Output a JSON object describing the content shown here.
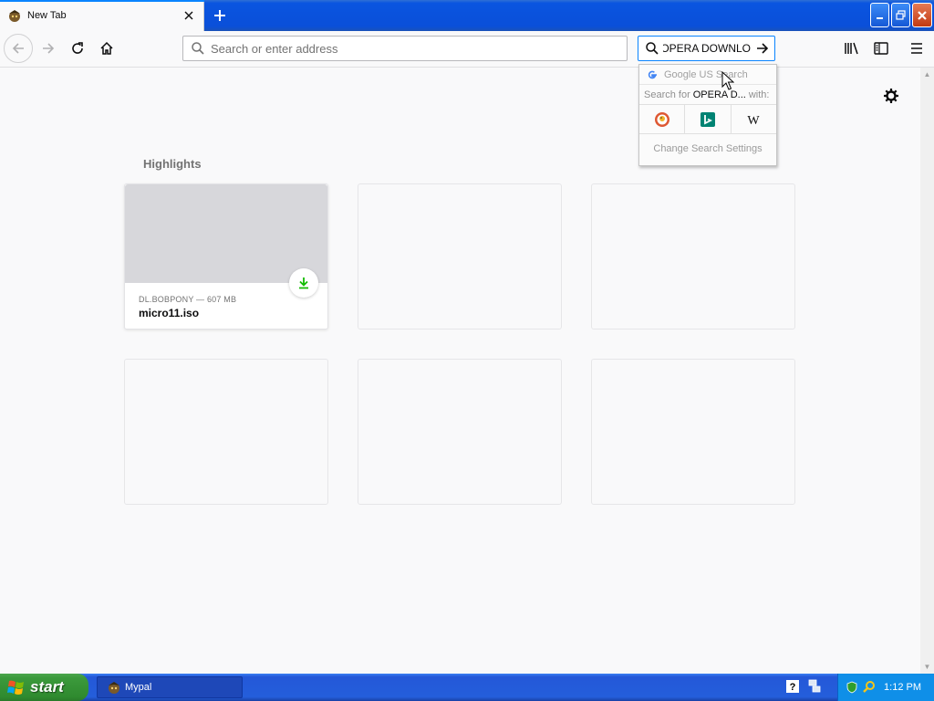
{
  "browser": {
    "tab": {
      "title": "New Tab"
    },
    "urlbar": {
      "placeholder": "Search or enter address"
    },
    "searchbar": {
      "value": "OPERA DOWNLO"
    }
  },
  "search_popup": {
    "default_engine": "Google US Search",
    "search_for_prefix": "Search for",
    "search_for_query": "OPERA D...",
    "search_for_suffix": "with:",
    "engines": [
      "duckduckgo-icon",
      "bing-icon",
      "wikipedia-icon"
    ],
    "settings_label": "Change Search Settings"
  },
  "newtab": {
    "highlights_title": "Highlights",
    "cards": [
      {
        "source": "DL.BOBPONY — 607 MB",
        "name": "micro11.iso",
        "type": "download"
      }
    ]
  },
  "taskbar": {
    "start_label": "start",
    "task": {
      "label": "Mypal"
    },
    "clock": "1:12 PM"
  },
  "colors": {
    "accent": "#0a84ff",
    "download_green": "#12bc00",
    "xp_blue": "#245edb",
    "xp_start_green": "#3c9a3c"
  }
}
